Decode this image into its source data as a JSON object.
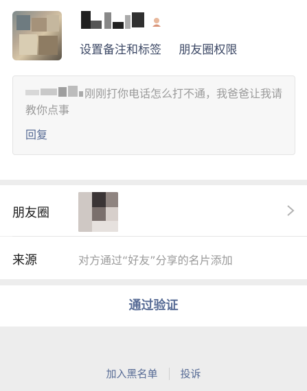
{
  "profile": {
    "set_remark_label": "设置备注和标签",
    "moments_permission_label": "朋友圈权限"
  },
  "greeting": {
    "message_visible": "刚刚打你电话怎么打不通，我爸爸让我请教你点事",
    "reply_label": "回复"
  },
  "moments": {
    "label": "朋友圈",
    "chevron": "chevron-right-icon"
  },
  "source": {
    "label": "来源",
    "value": "对方通过“好友”分享的名片添加"
  },
  "actions": {
    "verify_label": "通过验证",
    "blacklist_label": "加入黑名单",
    "report_label": "投诉"
  },
  "colors": {
    "link": "#576b95",
    "background": "#ededed"
  }
}
